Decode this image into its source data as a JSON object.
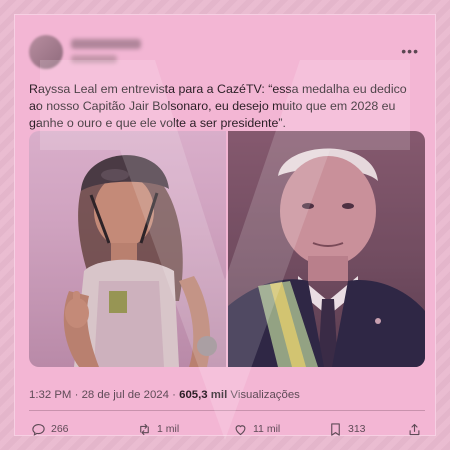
{
  "tweet": {
    "text": "Rayssa Leal em entrevista para a CazéTV: “essa medalha eu dedico ao nosso Capitão Jair Bolsonaro, eu desejo muito que em 2028 eu ganhe o ouro e que ele volte a ser presidente”.",
    "time": "1:32 PM",
    "date": "28 de jul de 2024",
    "views_count": "605,3 mil",
    "views_label": "Visualizações"
  },
  "actions": {
    "replies": "266",
    "retweets": "1 mil",
    "likes": "11 mil",
    "bookmarks": "313"
  },
  "icons": [
    "more-icon",
    "reply-icon",
    "retweet-icon",
    "like-icon",
    "bookmark-icon",
    "share-icon"
  ],
  "colors": {
    "background": "#e9b9cf",
    "card": "#f3b6d4",
    "text": "#2b1f26",
    "muted": "#5f4b57"
  }
}
